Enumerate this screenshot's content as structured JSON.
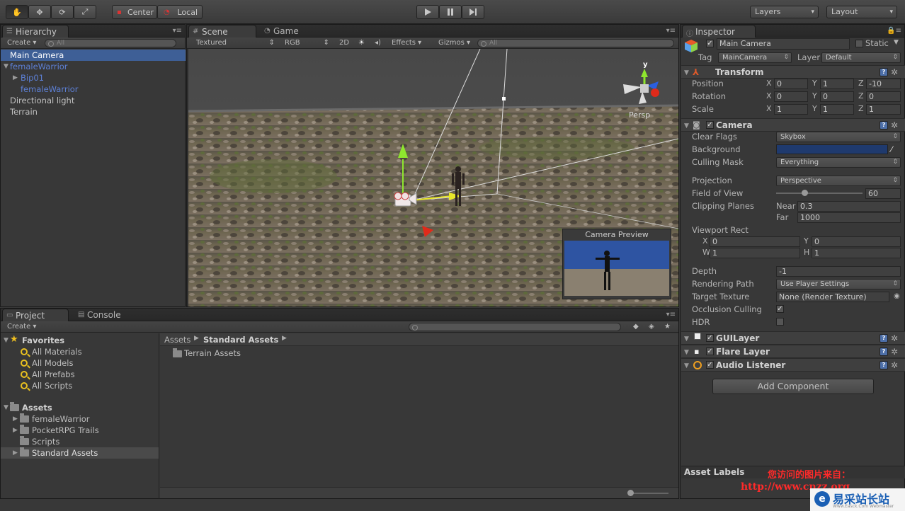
{
  "toolbar": {
    "hand": "✋",
    "move": "✥",
    "rotate": "⟳",
    "scale": "⤢",
    "center": "Center",
    "local": "Local",
    "layers": "Layers",
    "layout": "Layout"
  },
  "hierarchy": {
    "tab": "Hierarchy",
    "create": "Create",
    "search": "All",
    "items": [
      {
        "label": "Main Camera"
      },
      {
        "label": "femaleWarrior"
      },
      {
        "label": "Bip01"
      },
      {
        "label": "femaleWarrior"
      },
      {
        "label": "Directional light"
      },
      {
        "label": "Terrain"
      }
    ]
  },
  "scene": {
    "tab": "Scene",
    "game_tab": "Game",
    "shading": "Textured",
    "render_mode": "RGB",
    "two_d": "2D",
    "effects": "Effects",
    "gizmos": "Gizmos",
    "search": "All",
    "gizmo_y": "y",
    "persp": "Persp",
    "preview_title": "Camera Preview"
  },
  "project": {
    "tab": "Project",
    "console_tab": "Console",
    "create": "Create",
    "favorites": "Favorites",
    "fav_items": [
      "All Materials",
      "All Models",
      "All Prefabs",
      "All Scripts"
    ],
    "assets": "Assets",
    "asset_items": [
      "femaleWarrior",
      "PocketRPG Trails",
      "Scripts",
      "Standard Assets"
    ],
    "breadcrumb": [
      "Assets",
      "Standard Assets"
    ],
    "folder": "Terrain Assets"
  },
  "inspector": {
    "tab": "Inspector",
    "name": "Main Camera",
    "static": "Static",
    "tag_label": "Tag",
    "tag": "MainCamera",
    "layer_label": "Layer",
    "layer": "Default",
    "transform": {
      "title": "Transform",
      "rows": [
        {
          "label": "Position",
          "x": "0",
          "y": "1",
          "z": "-10"
        },
        {
          "label": "Rotation",
          "x": "0",
          "y": "0",
          "z": "0"
        },
        {
          "label": "Scale",
          "x": "1",
          "y": "1",
          "z": "1"
        }
      ]
    },
    "camera": {
      "title": "Camera",
      "clear_flags_label": "Clear Flags",
      "clear_flags": "Skybox",
      "background_label": "Background",
      "background_color": "#1f3a6e",
      "culling_label": "Culling Mask",
      "culling": "Everything",
      "projection_label": "Projection",
      "projection": "Perspective",
      "fov_label": "Field of View",
      "fov": "60",
      "fov_fraction": 0.33,
      "clip_label": "Clipping Planes",
      "near_label": "Near",
      "near": "0.3",
      "far_label": "Far",
      "far": "1000",
      "viewport_label": "Viewport Rect",
      "vx": "0",
      "vy": "0",
      "vw": "1",
      "vh": "1",
      "depth_label": "Depth",
      "depth": "-1",
      "rpath_label": "Rendering Path",
      "rpath": "Use Player Settings",
      "target_label": "Target Texture",
      "target": "None (Render Texture)",
      "occ_label": "Occlusion Culling",
      "hdr_label": "HDR"
    },
    "components": [
      "GUILayer",
      "Flare Layer",
      "Audio Listener"
    ],
    "add_component": "Add Component",
    "asset_labels": "Asset Labels"
  },
  "watermark": {
    "line1": "您访问的图片来自：",
    "line2": "http://www.cnzz.org",
    "brand": "易采站长站",
    "brand_sub": "Www.Easck.Com  Webmaster"
  },
  "colors": {
    "selection": "#3e5f96",
    "prefab_blue": "#5d80d6"
  }
}
